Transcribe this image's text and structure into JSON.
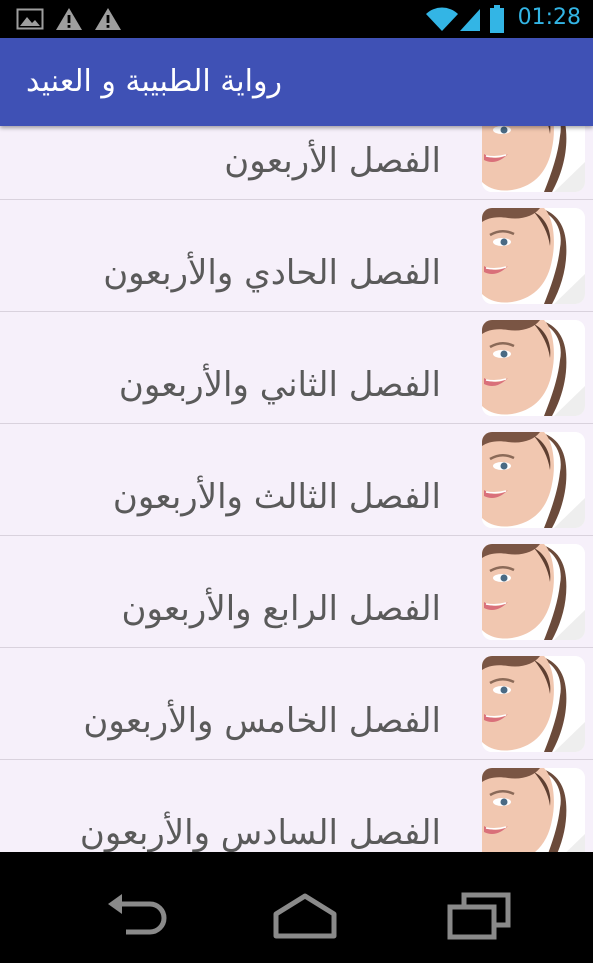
{
  "status_bar": {
    "time": "01:28",
    "icons": [
      "gallery-icon",
      "warning-icon",
      "warning-icon",
      "wifi-icon",
      "signal-icon",
      "battery-icon"
    ],
    "accent_color": "#33b5e5"
  },
  "app_bar": {
    "title": "رواية الطبيبة و العنيد",
    "color": "#3f51b5"
  },
  "chapters": [
    {
      "label": "الفصل الأربعون"
    },
    {
      "label": "الفصل الحادي والأربعون"
    },
    {
      "label": "الفصل الثاني والأربعون"
    },
    {
      "label": "الفصل الثالث والأربعون"
    },
    {
      "label": "الفصل الرابع والأربعون"
    },
    {
      "label": "الفصل الخامس والأربعون"
    },
    {
      "label": "الفصل السادس والأربعون"
    }
  ],
  "nav_bar": {
    "buttons": [
      "back-icon",
      "home-icon",
      "recent-apps-icon"
    ]
  }
}
